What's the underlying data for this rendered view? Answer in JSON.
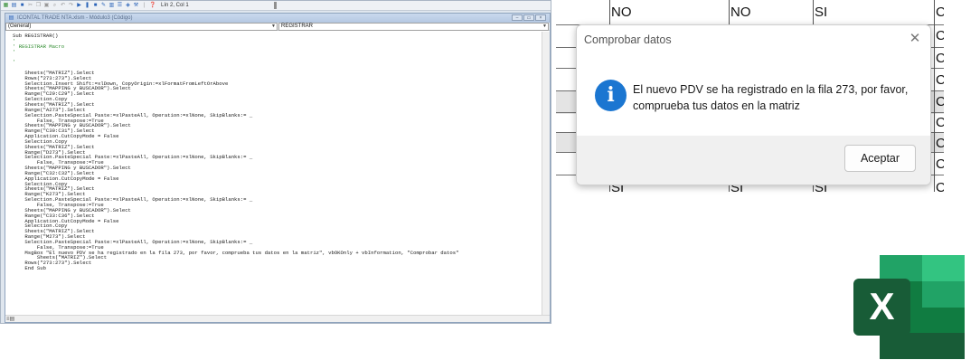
{
  "vba_editor": {
    "window_title": "ICONTAL TRADE NTA.xlsm - Módulo3 (Código)",
    "status_position": "Lín 2, Col 1",
    "left_combo": "(General)",
    "right_combo": "REGISTRAR",
    "code_lines": [
      {
        "text": "Sub REGISTRAR()",
        "type": "code"
      },
      {
        "text": "'",
        "type": "comment"
      },
      {
        "text": "' REGISTRAR Macro",
        "type": "comment"
      },
      {
        "text": "'",
        "type": "comment"
      },
      {
        "text": "",
        "type": "code"
      },
      {
        "text": "'",
        "type": "comment"
      },
      {
        "text": "",
        "type": "code"
      },
      {
        "text": "    Sheets(\"MATRIZ\").Select",
        "type": "code"
      },
      {
        "text": "    Rows(\"273:273\").Select",
        "type": "code"
      },
      {
        "text": "    Selection.Insert Shift:=xlDown, CopyOrigin:=xlFormatFromLeftOrAbove",
        "type": "code"
      },
      {
        "text": "    Sheets(\"MAPPING y BUSCADOR\").Select",
        "type": "code"
      },
      {
        "text": "    Range(\"C29:C29\").Select",
        "type": "code"
      },
      {
        "text": "    Selection.Copy",
        "type": "code"
      },
      {
        "text": "    Sheets(\"MATRIZ\").Select",
        "type": "code"
      },
      {
        "text": "    Range(\"A273\").Select",
        "type": "code"
      },
      {
        "text": "    Selection.PasteSpecial Paste:=xlPasteAll, Operation:=xlNone, SkipBlanks:= _",
        "type": "code"
      },
      {
        "text": "        False, Transpose:=True",
        "type": "code"
      },
      {
        "text": "    Sheets(\"MAPPING y BUSCADOR\").Select",
        "type": "code"
      },
      {
        "text": "    Range(\"C30:C31\").Select",
        "type": "code"
      },
      {
        "text": "    Application.CutCopyMode = False",
        "type": "code"
      },
      {
        "text": "    Selection.Copy",
        "type": "code"
      },
      {
        "text": "    Sheets(\"MATRIZ\").Select",
        "type": "code"
      },
      {
        "text": "    Range(\"D273\").Select",
        "type": "code"
      },
      {
        "text": "    Selection.PasteSpecial Paste:=xlPasteAll, Operation:=xlNone, SkipBlanks:= _",
        "type": "code"
      },
      {
        "text": "        False, Transpose:=True",
        "type": "code"
      },
      {
        "text": "    Sheets(\"MAPPING y BUSCADOR\").Select",
        "type": "code"
      },
      {
        "text": "    Range(\"C32:C32\").Select",
        "type": "code"
      },
      {
        "text": "    Application.CutCopyMode = False",
        "type": "code"
      },
      {
        "text": "    Selection.Copy",
        "type": "code"
      },
      {
        "text": "    Sheets(\"MATRIZ\").Select",
        "type": "code"
      },
      {
        "text": "    Range(\"K273\").Select",
        "type": "code"
      },
      {
        "text": "    Selection.PasteSpecial Paste:=xlPasteAll, Operation:=xlNone, SkipBlanks:= _",
        "type": "code"
      },
      {
        "text": "        False, Transpose:=True",
        "type": "code"
      },
      {
        "text": "    Sheets(\"MAPPING y BUSCADOR\").Select",
        "type": "code"
      },
      {
        "text": "    Range(\"C33:C36\").Select",
        "type": "code"
      },
      {
        "text": "    Application.CutCopyMode = False",
        "type": "code"
      },
      {
        "text": "    Selection.Copy",
        "type": "code"
      },
      {
        "text": "    Sheets(\"MATRIZ\").Select",
        "type": "code"
      },
      {
        "text": "    Range(\"M273\").Select",
        "type": "code"
      },
      {
        "text": "    Selection.PasteSpecial Paste:=xlPasteAll, Operation:=xlNone, SkipBlanks:= _",
        "type": "code"
      },
      {
        "text": "        False, Transpose:=True",
        "type": "code"
      },
      {
        "text": "    MsgBox \"El nuevo PDV se ha registrado en la fila 273, por favor, comprueba tus datos en la matriz\", vbOKOnly + vbInformation, \"Comprobar datos\"",
        "type": "code"
      },
      {
        "text": "        Sheets(\"MATRIZ\").Select",
        "type": "code"
      },
      {
        "text": "    Rows(\"273:273\").Select",
        "type": "code"
      },
      {
        "text": "    End Sub",
        "type": "code"
      }
    ]
  },
  "spreadsheet": {
    "top_row": [
      "NO",
      "NO",
      "SI",
      "C"
    ],
    "right_column": [
      "C",
      "C",
      "C",
      "C",
      "C",
      "C",
      "C",
      "C"
    ],
    "bottom_row": [
      "SI",
      "SI",
      "SI",
      "C"
    ]
  },
  "message_box": {
    "title": "Comprobar datos",
    "close_glyph": "✕",
    "icon_glyph": "i",
    "message_line1": "El nuevo PDV se ha registrado en la fila 273, por favor,",
    "message_line2": "comprueba tus datos en la matriz",
    "ok_label": "Aceptar"
  },
  "excel_logo": {
    "letter": "X",
    "colors": {
      "dark": "#185c37",
      "mid": "#21a366",
      "light": "#33c481",
      "base": "#107c41"
    }
  }
}
